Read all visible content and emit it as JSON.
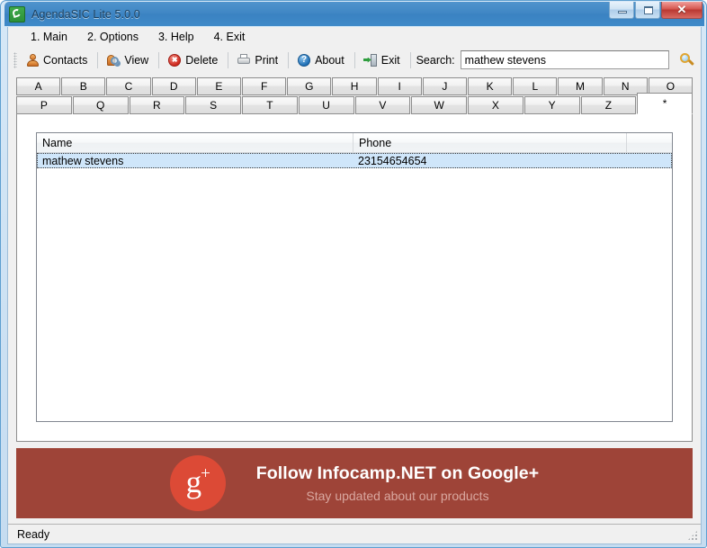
{
  "window": {
    "title": "AgendaSIC Lite 5.0.0",
    "icon": "phone-icon",
    "controls": {
      "minimize": "minimize-button",
      "maximize": "maximize-button",
      "close": "✕"
    }
  },
  "menubar": {
    "items": [
      {
        "label": "1. Main"
      },
      {
        "label": "2. Options"
      },
      {
        "label": "3. Help"
      },
      {
        "label": "4. Exit"
      }
    ]
  },
  "toolbar": {
    "buttons": [
      {
        "label": "Contacts",
        "icon": "contacts-icon"
      },
      {
        "label": "View",
        "icon": "view-icon"
      },
      {
        "label": "Delete",
        "icon": "delete-icon"
      },
      {
        "label": "Print",
        "icon": "print-icon"
      },
      {
        "label": "About",
        "icon": "about-icon"
      },
      {
        "label": "Exit",
        "icon": "exit-icon"
      }
    ],
    "search": {
      "label": "Search:",
      "value": "mathew stevens",
      "placeholder": "",
      "button_icon": "search-icon"
    }
  },
  "tabs": {
    "row1": [
      "A",
      "B",
      "C",
      "D",
      "E",
      "F",
      "G",
      "H",
      "I",
      "J",
      "K",
      "L",
      "M",
      "N",
      "O"
    ],
    "row2": [
      "P",
      "Q",
      "R",
      "S",
      "T",
      "U",
      "V",
      "W",
      "X",
      "Y",
      "Z",
      "*"
    ],
    "active": "*"
  },
  "list": {
    "columns": [
      "Name",
      "Phone",
      ""
    ],
    "rows": [
      {
        "name": "mathew stevens",
        "phone": "23154654654",
        "selected": true
      }
    ]
  },
  "banner": {
    "logo_letter": "g",
    "logo_plus": "+",
    "title": "Follow Infocamp.NET on Google+",
    "subtitle": "Stay updated about our products",
    "bg_color": "#9e4438",
    "logo_color": "#dc4a36"
  },
  "statusbar": {
    "text": "Ready"
  }
}
